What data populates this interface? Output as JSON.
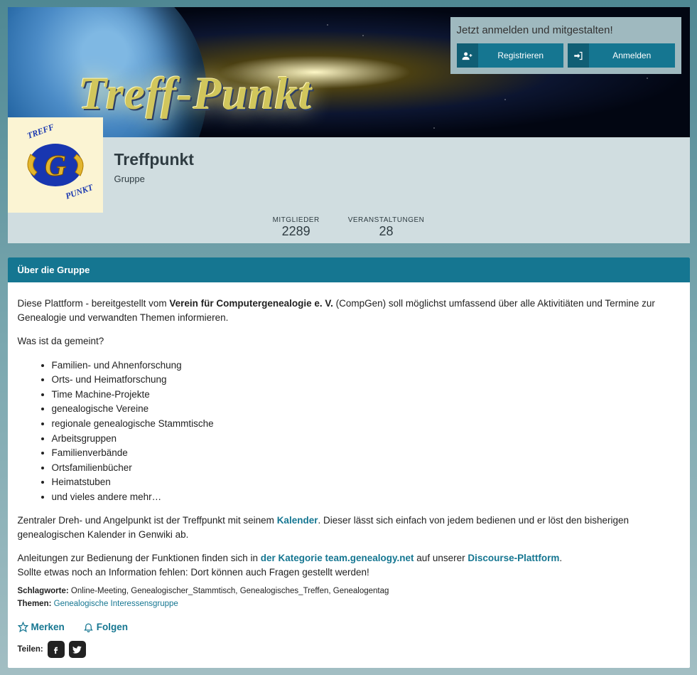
{
  "hero": {
    "wordmark": "Treff-Punkt",
    "auth": {
      "heading": "Jetzt anmelden und mitgestalten!",
      "register": "Registrieren",
      "login": "Anmelden"
    }
  },
  "group": {
    "title": "Treffpunkt",
    "type": "Gruppe"
  },
  "stats": {
    "members_label": "MITGLIEDER",
    "members_value": "2289",
    "events_label": "VERANSTALTUNGEN",
    "events_value": "28"
  },
  "about": {
    "heading": "Über die Gruppe",
    "intro_pre": "Diese Plattform - bereitgestellt vom ",
    "intro_bold": "Verein für Computergenealogie e. V.",
    "intro_post": " (CompGen) soll möglichst umfassend über alle Aktivitiäten und Termine zur Genealogie und verwandten Themen informieren.",
    "question": "Was ist da gemeint?",
    "items": [
      "Familien- und Ahnenforschung",
      "Orts- und Heimatforschung",
      "Time Machine-Projekte",
      "genealogische Vereine",
      "regionale genealogische Stammtische",
      "Arbeitsgruppen",
      "Familienverbände",
      "Ortsfamilienbücher",
      "Heimatstuben",
      "und vieles andere mehr…"
    ],
    "kalender_pre": "Zentraler Dreh- und Angelpunkt ist der Treffpunkt mit seinem ",
    "kalender_link": "Kalender",
    "kalender_post": ". Dieser lässt sich einfach von jedem bedienen und er löst den bisherigen genealogischen Kalender in Genwiki ab.",
    "help1_pre": "Anleitungen zur Bedienung der Funktionen finden sich in ",
    "help1_link1": "der Kategorie team.genealogy.net",
    "help1_mid": " auf unserer ",
    "help1_link2": "Discourse-Plattform",
    "help1_end": ".",
    "help2": "Sollte etwas noch an Information fehlen: Dort können auch Fragen gestellt werden!",
    "tags_label": "Schlagworte:",
    "tags_value": "Online-Meeting, Genealogischer_Stammtisch, Genealogisches_Treffen, Genealogentag",
    "topics_label": "Themen:",
    "topics_link": "Genealogische Interessensgruppe"
  },
  "actions": {
    "bookmark": "Merken",
    "follow": "Folgen",
    "share_label": "Teilen:"
  }
}
